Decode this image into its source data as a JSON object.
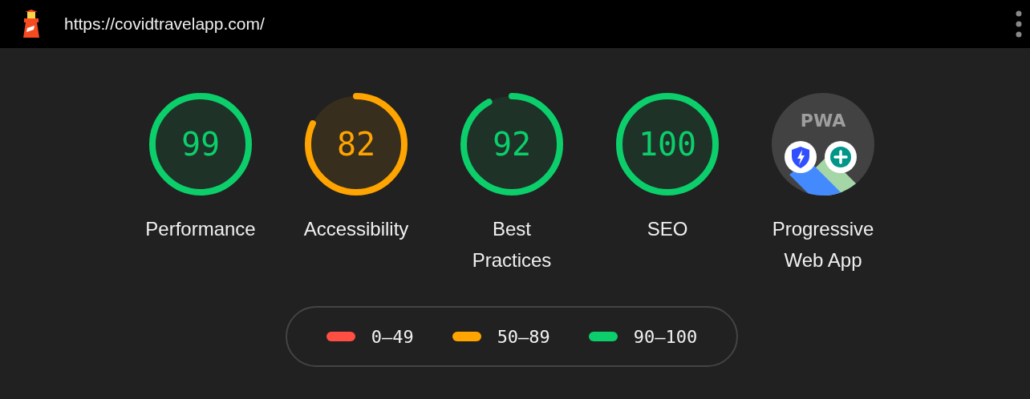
{
  "top_bar": {
    "url": "https://covidtravelapp.com/"
  },
  "gauges": [
    {
      "kind": "score",
      "score": "99",
      "level": 0.99,
      "color": "#0cce6b",
      "label": "Performance"
    },
    {
      "kind": "score",
      "score": "82",
      "level": 0.82,
      "color": "#ffa400",
      "label": "Accessibility"
    },
    {
      "kind": "score",
      "score": "92",
      "level": 0.92,
      "color": "#0cce6b",
      "label": "Best Practices"
    },
    {
      "kind": "score",
      "score": "100",
      "level": 1,
      "color": "#0cce6b",
      "label": "SEO"
    },
    {
      "kind": "pwa",
      "badge_text": "PWA",
      "label": "Progressive Web App"
    }
  ],
  "legend": [
    {
      "range": "0–49",
      "color": "#ff4e42"
    },
    {
      "range": "50–89",
      "color": "#ffa400"
    },
    {
      "range": "90–100",
      "color": "#0cce6b"
    }
  ]
}
